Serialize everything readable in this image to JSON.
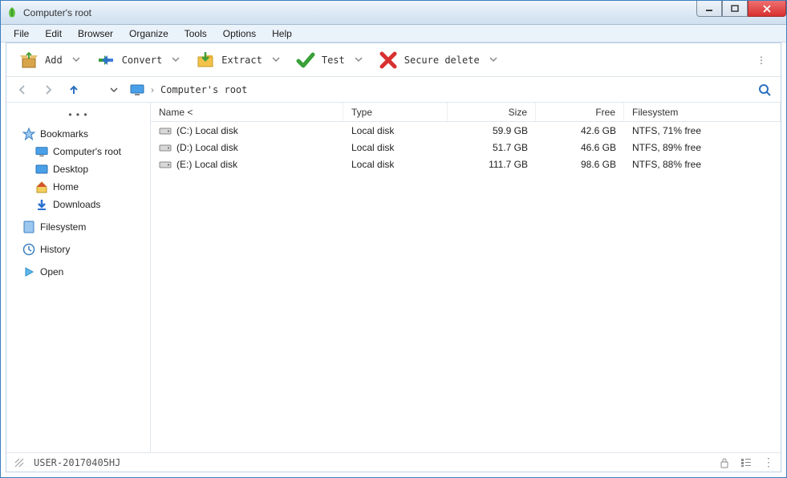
{
  "window": {
    "title": "Computer's root"
  },
  "menu": [
    "File",
    "Edit",
    "Browser",
    "Organize",
    "Tools",
    "Options",
    "Help"
  ],
  "toolbar": [
    {
      "id": "add",
      "label": "Add",
      "icon": "box-open"
    },
    {
      "id": "convert",
      "label": "Convert",
      "icon": "arrows"
    },
    {
      "id": "extract",
      "label": "Extract",
      "icon": "folder-down"
    },
    {
      "id": "test",
      "label": "Test",
      "icon": "check"
    },
    {
      "id": "secure-delete",
      "label": "Secure delete",
      "icon": "x"
    }
  ],
  "breadcrumb": {
    "text": "Computer's root"
  },
  "sidebar": {
    "bookmarks": {
      "label": "Bookmarks",
      "items": [
        {
          "id": "root",
          "label": "Computer's root",
          "icon": "monitor"
        },
        {
          "id": "desktop",
          "label": "Desktop",
          "icon": "desktop"
        },
        {
          "id": "home",
          "label": "Home",
          "icon": "home"
        },
        {
          "id": "downloads",
          "label": "Downloads",
          "icon": "download"
        }
      ]
    },
    "filesystem": {
      "label": "Filesystem"
    },
    "history": {
      "label": "History"
    },
    "open": {
      "label": "Open"
    }
  },
  "columns": {
    "name": "Name <",
    "type": "Type",
    "size": "Size",
    "free": "Free",
    "fs": "Filesystem"
  },
  "rows": [
    {
      "name": "(C:) Local disk",
      "type": "Local disk",
      "size": "59.9 GB",
      "free": "42.6 GB",
      "fs": "NTFS, 71% free"
    },
    {
      "name": "(D:) Local disk",
      "type": "Local disk",
      "size": "51.7 GB",
      "free": "46.6 GB",
      "fs": "NTFS, 89% free"
    },
    {
      "name": "(E:) Local disk",
      "type": "Local disk",
      "size": "111.7 GB",
      "free": "98.6 GB",
      "fs": "NTFS, 88% free"
    }
  ],
  "status": {
    "user": "USER-20170405HJ"
  }
}
